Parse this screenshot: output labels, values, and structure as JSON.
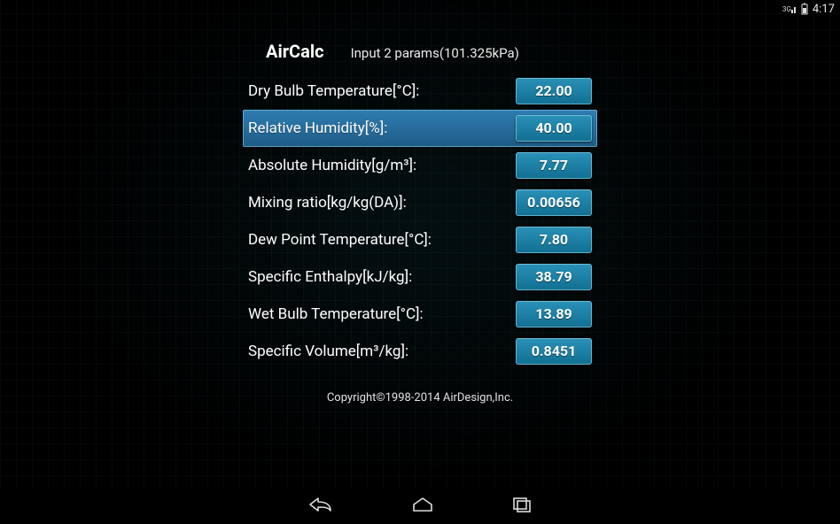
{
  "statusbar": {
    "clock": "4:17"
  },
  "app": {
    "title": "AirCalc",
    "subtitle": "Input 2 params(101.325kPa)"
  },
  "rows": [
    {
      "label": "Dry Bulb Temperature[°C]:",
      "value": "22.00",
      "highlight": false
    },
    {
      "label": "Relative Humidity[%]:",
      "value": "40.00",
      "highlight": true
    },
    {
      "label": "Absolute Humidity[g/m³]:",
      "value": "7.77",
      "highlight": false
    },
    {
      "label": "Mixing ratio[kg/kg(DA)]:",
      "value": "0.00656",
      "highlight": false
    },
    {
      "label": "Dew Point Temperature[°C]:",
      "value": "7.80",
      "highlight": false
    },
    {
      "label": "Specific Enthalpy[kJ/kg]:",
      "value": "38.79",
      "highlight": false
    },
    {
      "label": "Wet Bulb Temperature[°C]:",
      "value": "13.89",
      "highlight": false
    },
    {
      "label": "Specific Volume[m³/kg]:",
      "value": "0.8451",
      "highlight": false
    }
  ],
  "footer": "Copyright©1998-2014 AirDesign,Inc."
}
